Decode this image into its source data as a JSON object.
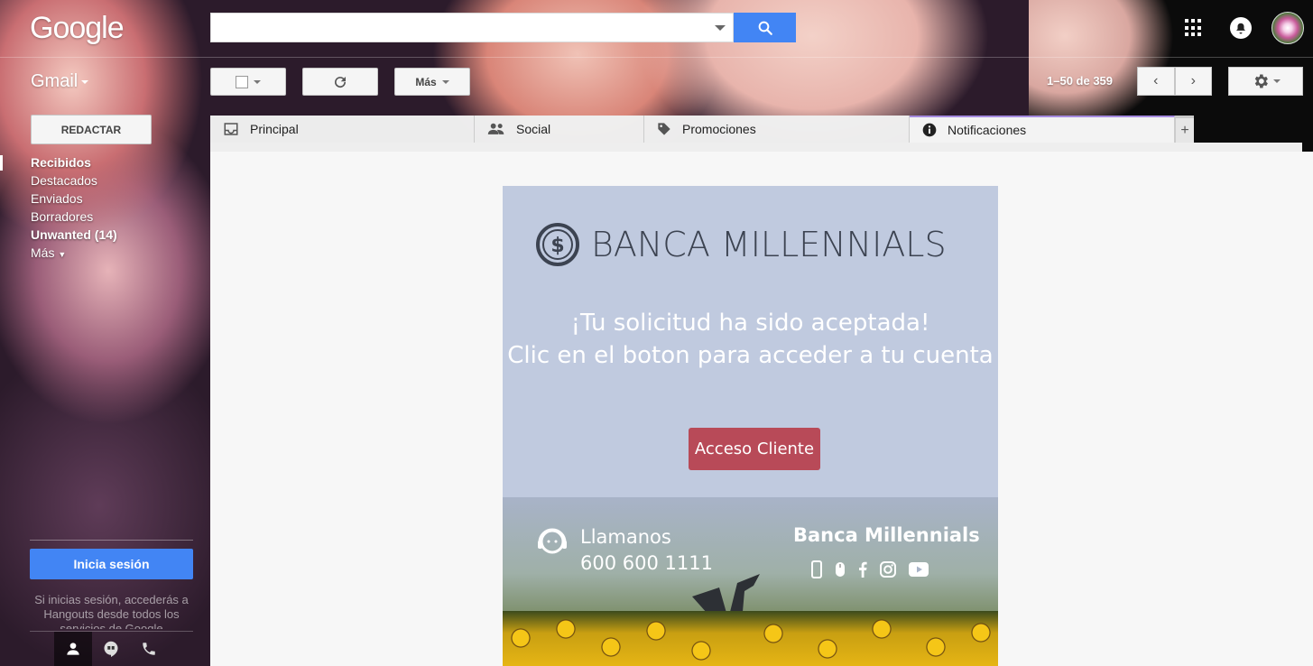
{
  "brand": {
    "logo_text": "Google"
  },
  "header": {
    "search": {
      "value": "",
      "placeholder": ""
    },
    "apps_icon": "apps-grid-icon",
    "notifications_icon": "bell-icon"
  },
  "app": {
    "name": "Gmail"
  },
  "toolbar": {
    "more_label": "Más",
    "pagination": "1–50 de 359"
  },
  "sidebar": {
    "compose_label": "REDACTAR",
    "folders": [
      {
        "label": "Recibidos",
        "bold": true
      },
      {
        "label": "Destacados",
        "bold": false
      },
      {
        "label": "Enviados",
        "bold": false
      },
      {
        "label": "Borradores",
        "bold": false
      },
      {
        "label": "Unwanted (14)",
        "bold": true
      },
      {
        "label": "Más",
        "bold": false
      }
    ],
    "signin_label": "Inicia sesión",
    "signin_note": "Si inicias sesión, accederás a Hangouts desde todos los servicios de Google"
  },
  "tabs": [
    {
      "label": "Principal",
      "icon": "inbox-icon"
    },
    {
      "label": "Social",
      "icon": "people-icon"
    },
    {
      "label": "Promociones",
      "icon": "tag-icon"
    },
    {
      "label": "Notificaciones",
      "icon": "info-icon"
    }
  ],
  "email": {
    "brand_name": "BANCA MILLENNIALS",
    "headline_line1": "¡Tu solicitud ha sido aceptada!",
    "headline_line2": "Clic en el boton para acceder a tu cuenta",
    "cta_label": "Acceso Cliente",
    "call_label": "Llamanos",
    "call_number": "600 600 1111",
    "footer_brand": "Banca Millennials"
  },
  "colors": {
    "accent_blue": "#4285f4",
    "email_bg": "#c0cadf",
    "cta_bg": "#b84a58",
    "active_tab_indicator": "#a58be0"
  }
}
